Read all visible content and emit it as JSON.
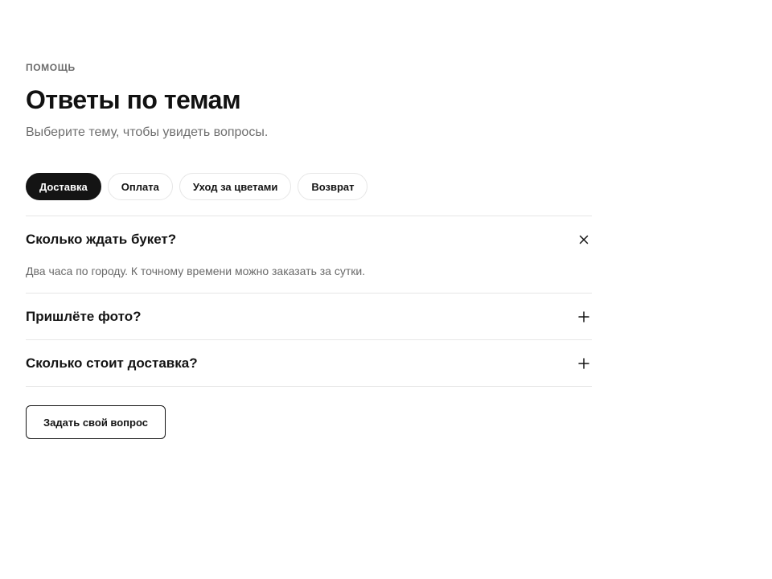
{
  "header": {
    "eyebrow": "ПОМОЩЬ",
    "title": "Ответы по темам",
    "subtitle": "Выберите тему, чтобы увидеть вопросы."
  },
  "topics": [
    {
      "label": "Доставка",
      "active": true
    },
    {
      "label": "Оплата",
      "active": false
    },
    {
      "label": "Уход за цветами",
      "active": false
    },
    {
      "label": "Возврат",
      "active": false
    }
  ],
  "faq": [
    {
      "question": "Сколько ждать букет?",
      "answer": "Два часа по городу. К точному времени можно заказать за сутки.",
      "expanded": true,
      "icon": "close-icon"
    },
    {
      "question": "Пришлёте фото?",
      "answer": "",
      "expanded": false,
      "icon": "plus-icon"
    },
    {
      "question": "Сколько стоит доставка?",
      "answer": "",
      "expanded": false,
      "icon": "plus-icon"
    }
  ],
  "cta": {
    "ask_label": "Задать свой вопрос"
  },
  "colors": {
    "text": "#141414",
    "muted": "#6f6f6f",
    "divider": "#e7e7e7",
    "active_chip_bg": "#141414",
    "background": "#ffffff"
  }
}
